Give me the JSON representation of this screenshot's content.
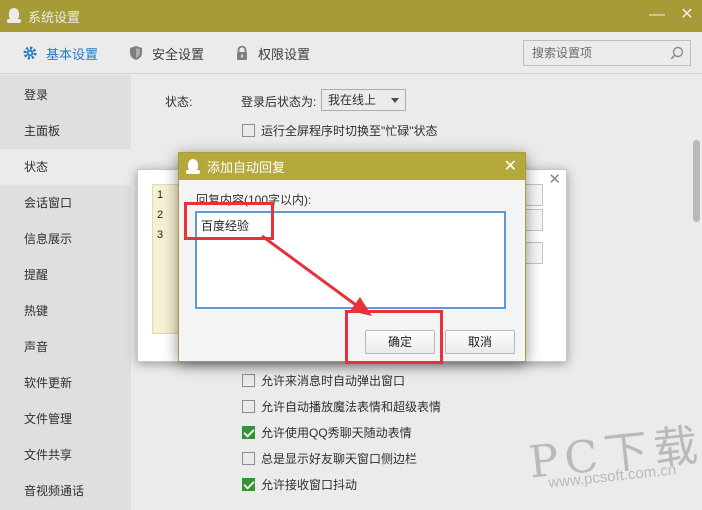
{
  "window": {
    "title": "系统设置",
    "min_glyph": "—",
    "close_glyph": "✕"
  },
  "tabs": [
    {
      "label": "基本设置",
      "icon": "gear-icon",
      "active": true
    },
    {
      "label": "安全设置",
      "icon": "shield-icon",
      "active": false
    },
    {
      "label": "权限设置",
      "icon": "lock-icon",
      "active": false
    }
  ],
  "search": {
    "placeholder": "搜索设置项",
    "icon": "search-icon"
  },
  "sidebar": {
    "items": [
      {
        "label": "登录"
      },
      {
        "label": "主面板"
      },
      {
        "label": "状态"
      },
      {
        "label": "会话窗口"
      },
      {
        "label": "信息展示"
      },
      {
        "label": "提醒"
      },
      {
        "label": "热键"
      },
      {
        "label": "声音"
      },
      {
        "label": "软件更新"
      },
      {
        "label": "文件管理"
      },
      {
        "label": "文件共享"
      },
      {
        "label": "音视频通话"
      }
    ]
  },
  "status": {
    "section_label": "状态:",
    "login_status_label": "登录后状态为:",
    "login_status_value": "我在线上",
    "fullscreen_busy": "运行全屏程序时切换至\"忙碌\"状态"
  },
  "checkboxes": [
    {
      "label": "允许来消息时自动弹出窗口",
      "checked": false
    },
    {
      "label": "允许自动播放魔法表情和超级表情",
      "checked": false
    },
    {
      "label": "允许使用QQ秀聊天随动表情",
      "checked": true
    },
    {
      "label": "总是显示好友聊天窗口侧边栏",
      "checked": false
    },
    {
      "label": "允许接收窗口抖动",
      "checked": true
    }
  ],
  "back_dialog": {
    "line_numbers": [
      "1",
      "2",
      "3"
    ],
    "close_glyph": "✕"
  },
  "dialog": {
    "title": "添加自动回复",
    "close_glyph": "✕",
    "content_label": "回复内容(100字以内):",
    "content_value": "百度经验",
    "ok_label": "确定",
    "cancel_label": "取消"
  },
  "watermark": {
    "brand": "PC下载网",
    "url": "www.pcsoft.com.cn"
  },
  "colors": {
    "titlebar": "#b5a93c",
    "accent": "#2b86d4",
    "annotation": "#e8323a",
    "checked": "#3aa03a"
  }
}
